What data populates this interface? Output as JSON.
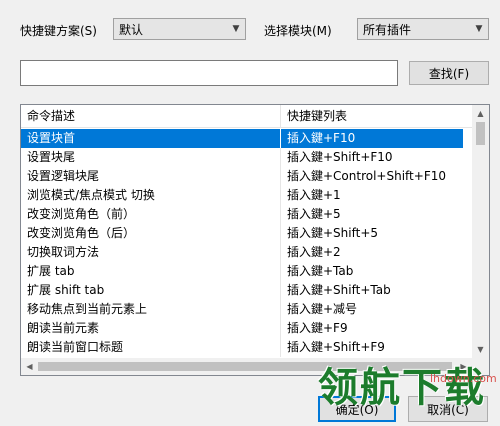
{
  "toolbar": {
    "scheme_label": "快捷键方案(S)",
    "scheme_value": "默认",
    "module_label": "选择模块(M)",
    "module_value": "所有插件",
    "search_value": "",
    "find_label": "查找(F)"
  },
  "table": {
    "columns": [
      "命令描述",
      "快捷键列表"
    ],
    "rows": [
      {
        "command": "设置块首",
        "shortcut": "插入鍵+F10"
      },
      {
        "command": "设置块尾",
        "shortcut": "插入鍵+Shift+F10"
      },
      {
        "command": "设置逻辑块尾",
        "shortcut": "插入鍵+Control+Shift+F10"
      },
      {
        "command": "浏览模式/焦点模式 切换",
        "shortcut": "插入鍵+1"
      },
      {
        "command": "改变浏览角色（前）",
        "shortcut": "插入鍵+5"
      },
      {
        "command": "改变浏览角色（后）",
        "shortcut": "插入鍵+Shift+5"
      },
      {
        "command": "切换取词方法",
        "shortcut": "插入鍵+2"
      },
      {
        "command": "扩展 tab",
        "shortcut": "插入鍵+Tab"
      },
      {
        "command": "扩展 shift tab",
        "shortcut": "插入鍵+Shift+Tab"
      },
      {
        "command": "移动焦点到当前元素上",
        "shortcut": "插入鍵+减号"
      },
      {
        "command": "朗读当前元素",
        "shortcut": "插入鍵+F9"
      },
      {
        "command": "朗读当前窗口标题",
        "shortcut": "插入鍵+Shift+F9"
      }
    ],
    "selected_index": 0
  },
  "footer": {
    "ok_label": "确定(O)",
    "cancel_label": "取消(C)"
  },
  "watermark": {
    "text": "领航下载",
    "site": "lhdown.com"
  }
}
